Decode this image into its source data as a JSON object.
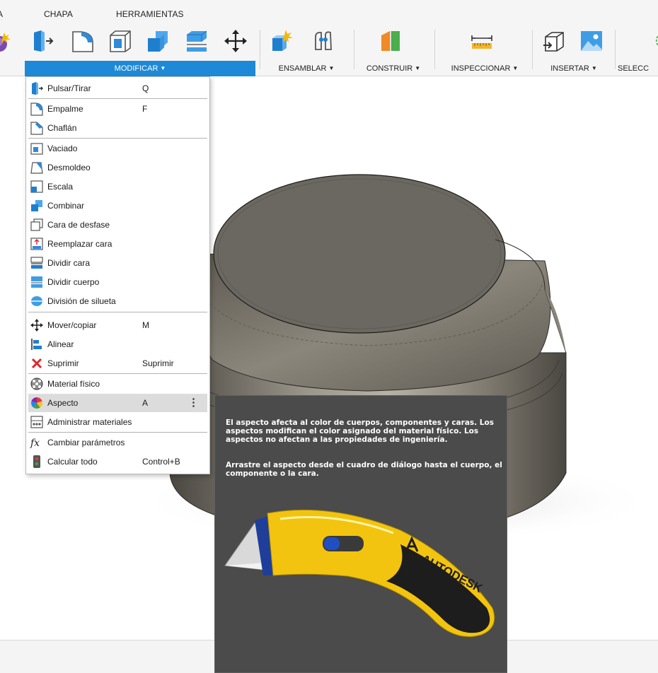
{
  "tabs": {
    "partial_left": "A",
    "chapa": "CHAPA",
    "herramientas": "HERRAMIENTAS"
  },
  "groups": {
    "modificar": "MODIFICAR",
    "ensamblar": "ENSAMBLAR",
    "construir": "CONSTRUIR",
    "inspeccionar": "INSPECCIONAR",
    "insertar": "INSERTAR",
    "seleccionar_partial": "SELECC"
  },
  "toolbar_icons": [
    "create-form-icon",
    "press-pull-icon",
    "fillet-icon",
    "shell-icon",
    "combine-icon",
    "split-body-icon",
    "move-icon",
    "new-component-icon",
    "joint-icon",
    "construction-plane-icon",
    "measure-icon",
    "insert-mesh-icon",
    "insert-image-icon",
    "select-icon"
  ],
  "menu": {
    "items": [
      {
        "label": "Pulsar/Tirar",
        "key": "Q",
        "icon": "press-pull-icon"
      },
      {
        "label": "Empalme",
        "key": "F",
        "icon": "fillet-icon"
      },
      {
        "label": "Chaflán",
        "key": "",
        "icon": "chamfer-icon"
      },
      {
        "label": "Vaciado",
        "key": "",
        "icon": "shell-icon"
      },
      {
        "label": "Desmoldeo",
        "key": "",
        "icon": "draft-icon"
      },
      {
        "label": "Escala",
        "key": "",
        "icon": "scale-icon"
      },
      {
        "label": "Combinar",
        "key": "",
        "icon": "combine-icon"
      },
      {
        "label": "Cara de desfase",
        "key": "",
        "icon": "offset-face-icon"
      },
      {
        "label": "Reemplazar cara",
        "key": "",
        "icon": "replace-face-icon"
      },
      {
        "label": "Dividir cara",
        "key": "",
        "icon": "split-face-icon"
      },
      {
        "label": "Dividir cuerpo",
        "key": "",
        "icon": "split-body-icon"
      },
      {
        "label": "División de silueta",
        "key": "",
        "icon": "silhouette-split-icon"
      },
      {
        "label": "Mover/copiar",
        "key": "M",
        "icon": "move-icon"
      },
      {
        "label": "Alinear",
        "key": "",
        "icon": "align-icon"
      },
      {
        "label": "Suprimir",
        "key": "Suprimir",
        "icon": "delete-icon"
      },
      {
        "label": "Material físico",
        "key": "",
        "icon": "physical-material-icon"
      },
      {
        "label": "Aspecto",
        "key": "A",
        "icon": "appearance-icon",
        "highlighted": true
      },
      {
        "label": "Administrar materiales",
        "key": "",
        "icon": "manage-materials-icon"
      },
      {
        "label": "Cambiar parámetros",
        "key": "",
        "icon": "parameters-icon"
      },
      {
        "label": "Calcular todo",
        "key": "Control+B",
        "icon": "compute-all-icon"
      }
    ],
    "more_glyph": "⋮"
  },
  "tooltip": {
    "text1": "El aspecto afecta al color de cuerpos, componentes y caras. Los aspectos modifican el color asignado del material físico. Los aspectos no afectan a las propiedades de ingeniería.",
    "text2": "Arrastre el aspecto desde el cuadro de diálogo hasta el cuerpo, el componente o la cara.",
    "image_brand": "AUTODESK"
  },
  "colors": {
    "accent": "#1e89d6",
    "tooltip_bg": "#4b4b4b",
    "knife_yellow": "#f2c40f",
    "delete_red": "#e0262a"
  }
}
